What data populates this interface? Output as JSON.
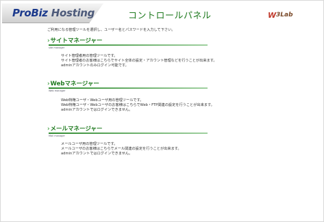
{
  "header": {
    "logo_pro": "ProBiz",
    "logo_hosting": "Hosting",
    "title": "コントロールパネル",
    "brand_mark": "W",
    "brand_name": "3Lab"
  },
  "intro": "ご利用になる管理ツールを選択し、ユーザー名とパスワードを入力して下さい。",
  "sections": [
    {
      "title": "サイトマネージャー",
      "subtitle": "site manager",
      "lines": [
        "サイト管理者用の管理ツールです。",
        "サイト管理者のお客様はこちらでサイト全体の設定・アカウント管理などを行うことが出来ます。",
        "adminアカウントのみログイン可能です。"
      ]
    },
    {
      "title": "Webマネージャー",
      "subtitle": "Web manager",
      "lines": [
        "Web特権ユーザ・Webユーザ用の管理ツールです。",
        "Web特権ユーザ・Webユーザのお客様はこちらでWeb・FTP関連の設定を行うことが出来ます。",
        "adminアカウントではログインできません。"
      ]
    },
    {
      "title": "メールマネージャー",
      "subtitle": "Mail manager",
      "lines": [
        "メールユーザ用の管理ツールです。",
        "メールユーザのお客様はこちらでメール関連の設定を行うことが出来ます。",
        "adminアカウントではログインできません。"
      ]
    }
  ]
}
